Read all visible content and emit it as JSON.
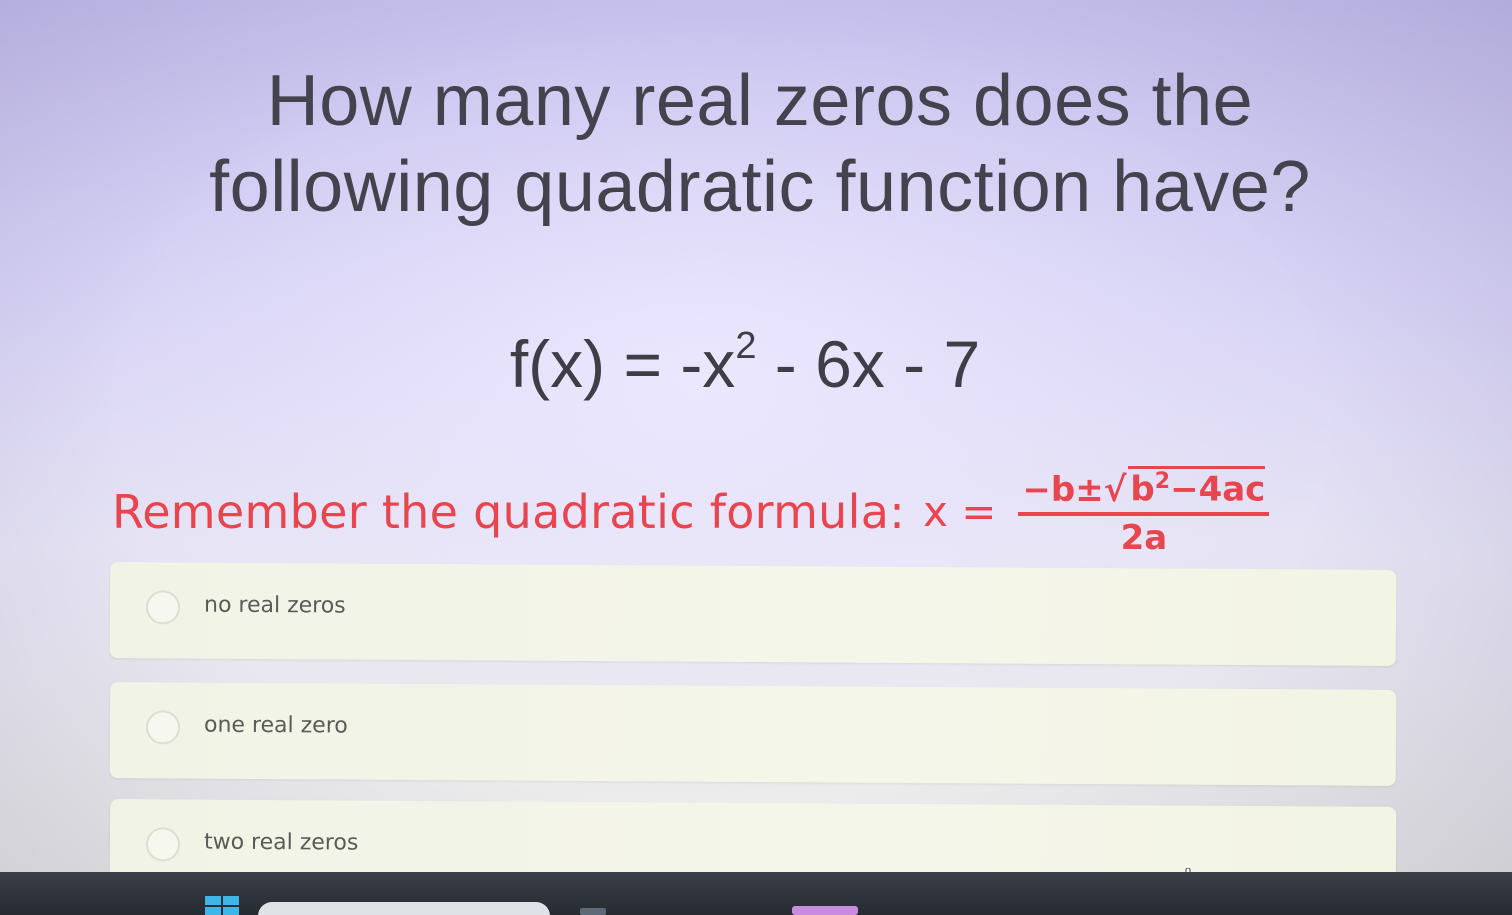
{
  "question": {
    "line1": "How many real zeros does the",
    "line2": "following quadratic function have?"
  },
  "equation": {
    "lhs": "f(x) = -x",
    "exponent": "2",
    "rhs": " - 6x - 7"
  },
  "reminder": {
    "text": "Remember the quadratic formula:",
    "x_equals": "x =",
    "numerator_pre": "−b±√",
    "numerator_rad": "b",
    "numerator_exp": "2",
    "numerator_post": "−4ac",
    "denominator": "2a"
  },
  "choices": [
    {
      "label": "no real zeros"
    },
    {
      "label": "one real zero"
    },
    {
      "label": "two real zeros"
    }
  ],
  "colors": {
    "accent_red": "#e8454f",
    "question_text": "#44424c",
    "taskbar": "#2b2f36",
    "start_icon": "#3fb6e8"
  },
  "icons": {
    "taskbar_start": "windows-start-icon",
    "cursor": "hand-pointer-icon"
  }
}
